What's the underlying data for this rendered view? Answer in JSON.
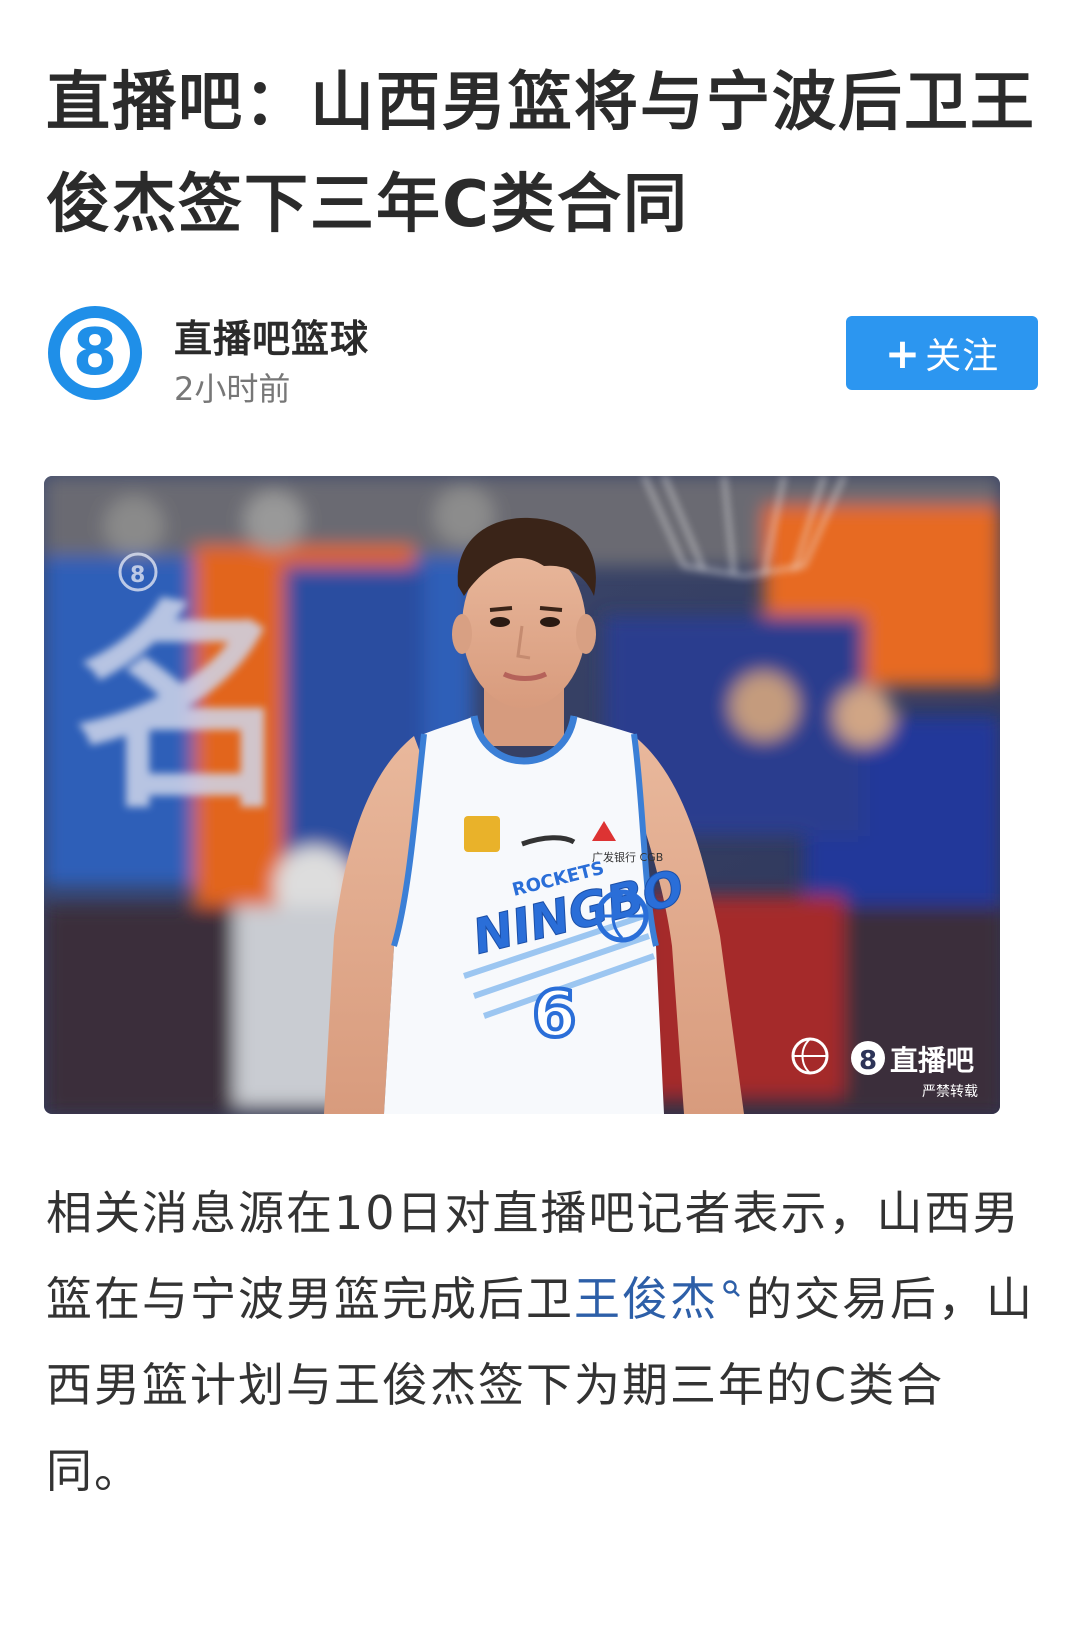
{
  "article": {
    "title": "直播吧：山西男篮将与宁波后卫王俊杰签下三年C类合同",
    "author": {
      "avatar_glyph": "8",
      "name": "直播吧篮球",
      "time": "2小时前"
    },
    "follow": {
      "plus": "+",
      "label": "关注"
    },
    "photo": {
      "jersey_team_small": "ROCKETS",
      "jersey_team": "NINGBO",
      "jersey_number": "6",
      "sponsor_text": "广发银行 CGB",
      "watermark_logo": "8",
      "watermark_brand": "直播吧",
      "watermark_note": "严禁转载",
      "corner_badge": "8"
    },
    "body": {
      "part1": "相关消息源在10日对直播吧记者表示，山西男篮在与宁波男篮完成后卫",
      "link": "王俊杰",
      "part2": "的交易后，山西男篮计划与王俊杰签下为期三年的C类合同。"
    }
  },
  "colors": {
    "accent": "#2c96f0",
    "link": "#2d5fa8",
    "avatar": "#1f8fe8"
  }
}
